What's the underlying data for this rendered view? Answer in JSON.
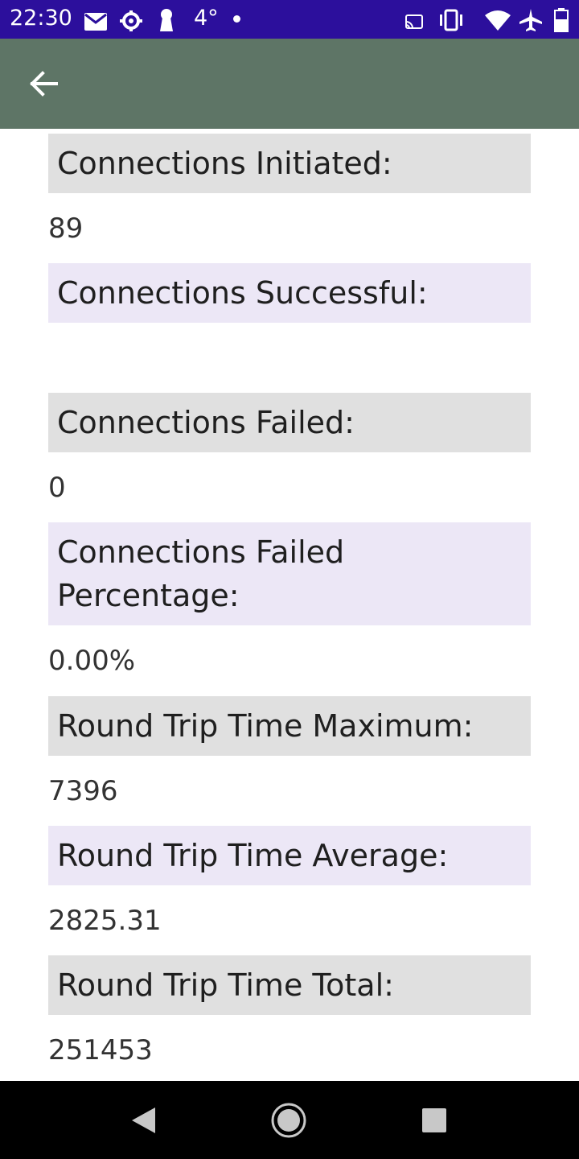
{
  "status_bar": {
    "time": "22:30",
    "temperature": "4°",
    "left_icons": [
      "mail-icon",
      "settings-gear-icon",
      "keyhole-icon"
    ],
    "right_icons": [
      "cast-icon",
      "vibrate-icon",
      "wifi-icon",
      "airplane-icon",
      "battery-icon"
    ]
  },
  "app_bar": {
    "back_icon": "arrow-back-icon"
  },
  "stats": [
    {
      "label": "Connections Initiated:",
      "value": "89"
    },
    {
      "label": "Connections Successful:",
      "value": ""
    },
    {
      "label": "Connections Failed:",
      "value": "0"
    },
    {
      "label": "Connections Failed Percentage:",
      "value": "0.00%"
    },
    {
      "label": "Round Trip Time Maximum:",
      "value": "7396"
    },
    {
      "label": "Round Trip Time Average:",
      "value": "2825.31"
    },
    {
      "label": "Round Trip Time Total:",
      "value": "251453"
    }
  ],
  "colors": {
    "status_bar": "#2c0f9c",
    "app_bar": "#5e7566",
    "header_gray": "#e0e0e0",
    "header_lavender": "#ece7f6"
  },
  "nav_bar": {
    "icons": [
      "nav-back-icon",
      "nav-home-icon",
      "nav-recents-icon"
    ]
  }
}
